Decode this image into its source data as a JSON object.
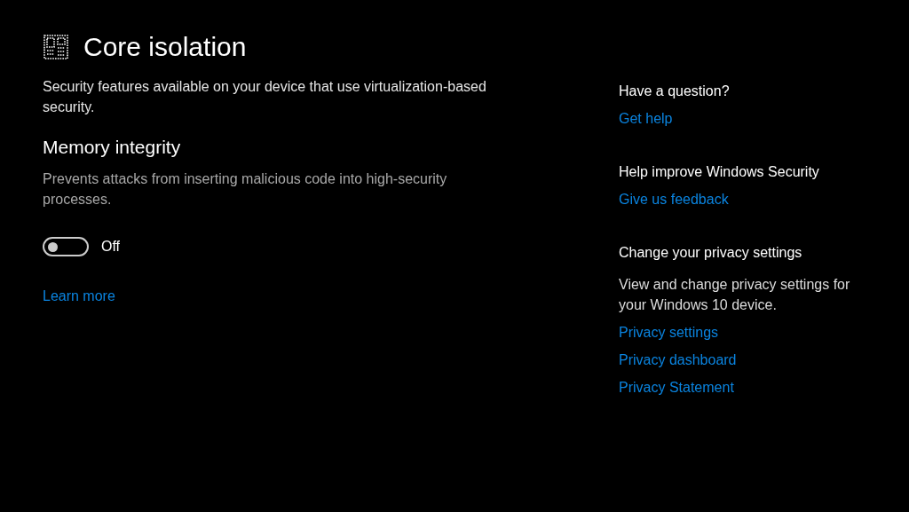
{
  "page": {
    "title": "Core isolation",
    "description": "Security features available on your device that use virtualization-based security."
  },
  "feature": {
    "title": "Memory integrity",
    "description": "Prevents attacks from inserting malicious code into high-security processes.",
    "toggle": {
      "on": false,
      "label": "Off"
    },
    "link": "Learn more"
  },
  "sidebar": [
    {
      "heading": "Have a question?",
      "links": [
        "Get help"
      ]
    },
    {
      "heading": "Help improve Windows Security",
      "links": [
        "Give us feedback"
      ]
    },
    {
      "heading": "Change your privacy settings",
      "description": "View and change privacy settings for your Windows 10 device.",
      "links": [
        "Privacy settings",
        "Privacy dashboard",
        "Privacy Statement"
      ]
    }
  ]
}
